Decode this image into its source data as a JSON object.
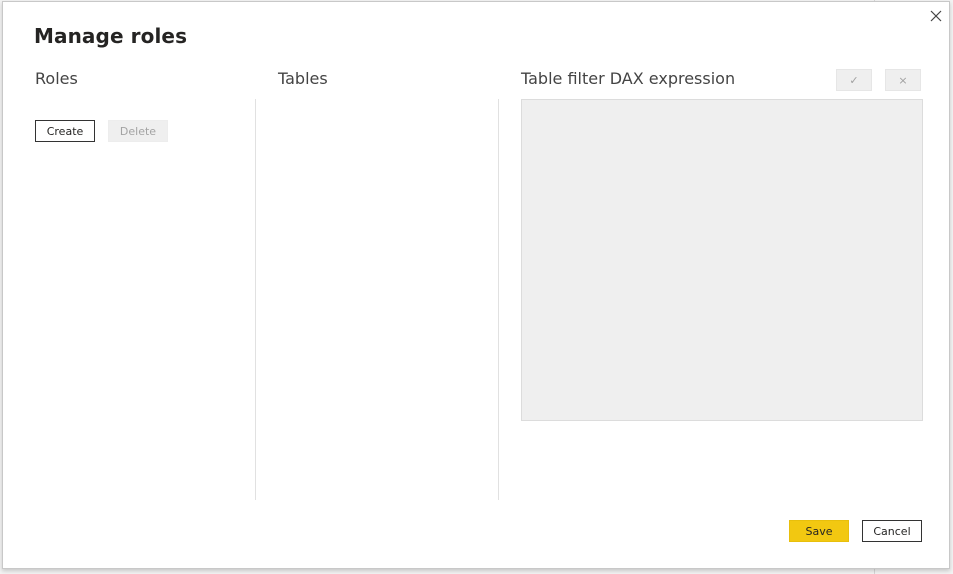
{
  "dialog": {
    "title": "Manage roles",
    "close_icon": "close-icon"
  },
  "roles": {
    "header": "Roles",
    "create_label": "Create",
    "delete_label": "Delete"
  },
  "tables": {
    "header": "Tables"
  },
  "dax": {
    "header": "Table filter DAX expression",
    "confirm_glyph": "✓",
    "discard_glyph": "×",
    "confirm_icon": "check-icon",
    "discard_icon": "x-icon"
  },
  "footer": {
    "save_label": "Save",
    "cancel_label": "Cancel"
  },
  "colors": {
    "accent": "#f2c811",
    "editor_bg": "#efefef",
    "text": "#252423"
  }
}
